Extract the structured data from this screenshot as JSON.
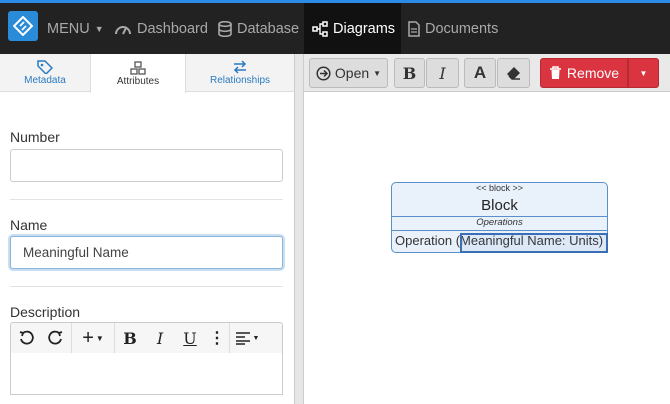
{
  "nav": {
    "menu_label": "MENU",
    "items": [
      {
        "label": "Dashboard",
        "icon": "dashboard-icon"
      },
      {
        "label": "Database",
        "icon": "database-icon"
      },
      {
        "label": "Diagrams",
        "icon": "diagram-icon",
        "active": true
      },
      {
        "label": "Documents",
        "icon": "document-icon"
      }
    ]
  },
  "left_tabs": [
    {
      "label": "Metadata",
      "icon": "tag-icon"
    },
    {
      "label": "Attributes",
      "icon": "cubes-icon",
      "active": true
    },
    {
      "label": "Relationships",
      "icon": "exchange-icon"
    }
  ],
  "form": {
    "number_label": "Number",
    "number_value": "",
    "name_label": "Name",
    "name_value": "Meaningful Name",
    "description_label": "Description"
  },
  "toolbar": {
    "open_label": "Open",
    "bold_label": "B",
    "italic_label": "I",
    "font_label": "A",
    "remove_label": "Remove"
  },
  "editor_toolbar": [
    "undo",
    "redo",
    "insert",
    "bold",
    "italic",
    "underline",
    "more",
    "align"
  ],
  "block": {
    "stereotype": "<< block >>",
    "name": "Block",
    "compartment": "Operations",
    "operation": "Operation (Meaningful Name: Units)"
  },
  "colors": {
    "accent": "#2a8bd8",
    "danger": "#d9343f",
    "nav_bg": "#222222"
  }
}
